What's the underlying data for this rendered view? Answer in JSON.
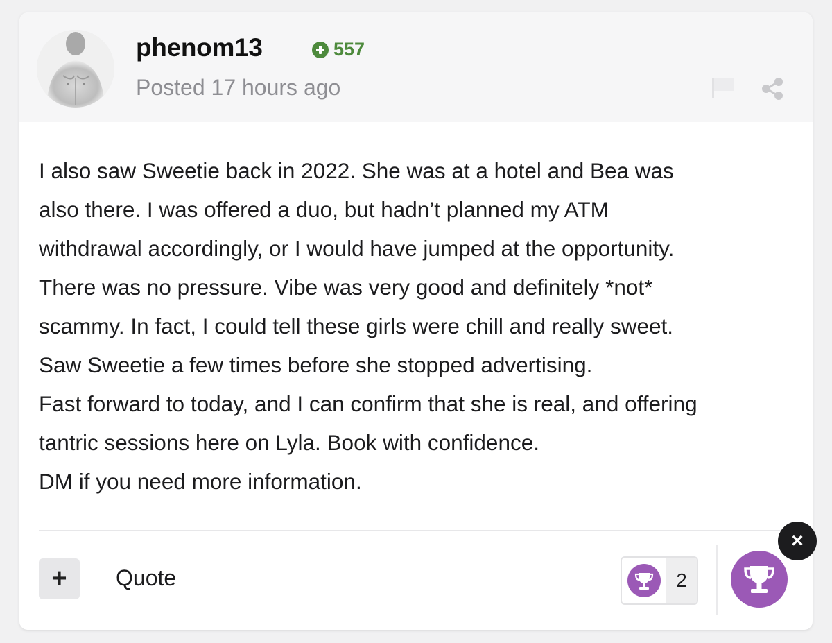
{
  "post": {
    "author": {
      "username": "phenom13",
      "reputation": "557",
      "avatar_icon": "user-avatar-photo"
    },
    "posted_text": "Posted 17 hours ago",
    "body_lines": [
      "I also saw Sweetie back in 2022. She was at a hotel and Bea was",
      "also there. I was offered a duo, but hadn’t planned my ATM",
      "withdrawal accordingly, or I would have jumped at the opportunity.",
      "There was no pressure. Vibe was very good and definitely *not*",
      "scammy. In fact, I could tell these girls were chill and really sweet.",
      "Saw Sweetie a few times before she stopped advertising.",
      "Fast forward to today, and I can confirm that she is real, and offering",
      "tantric sessions here on Lyla. Book with confidence.",
      "DM if you need more information."
    ],
    "actions": {
      "multiquote_label": "+",
      "quote_label": "Quote",
      "reaction_count": "2",
      "close_label": "×"
    }
  },
  "colors": {
    "reputation_green": "#4d8a3c",
    "reaction_purple": "#9b59b6",
    "close_button_bg": "#1c1c1e",
    "muted_text": "#8e8e93"
  },
  "icons": {
    "reputation": "plus-circle-icon",
    "report": "flag-icon",
    "share": "share-icon",
    "reaction": "trophy-icon",
    "close": "close-icon"
  }
}
